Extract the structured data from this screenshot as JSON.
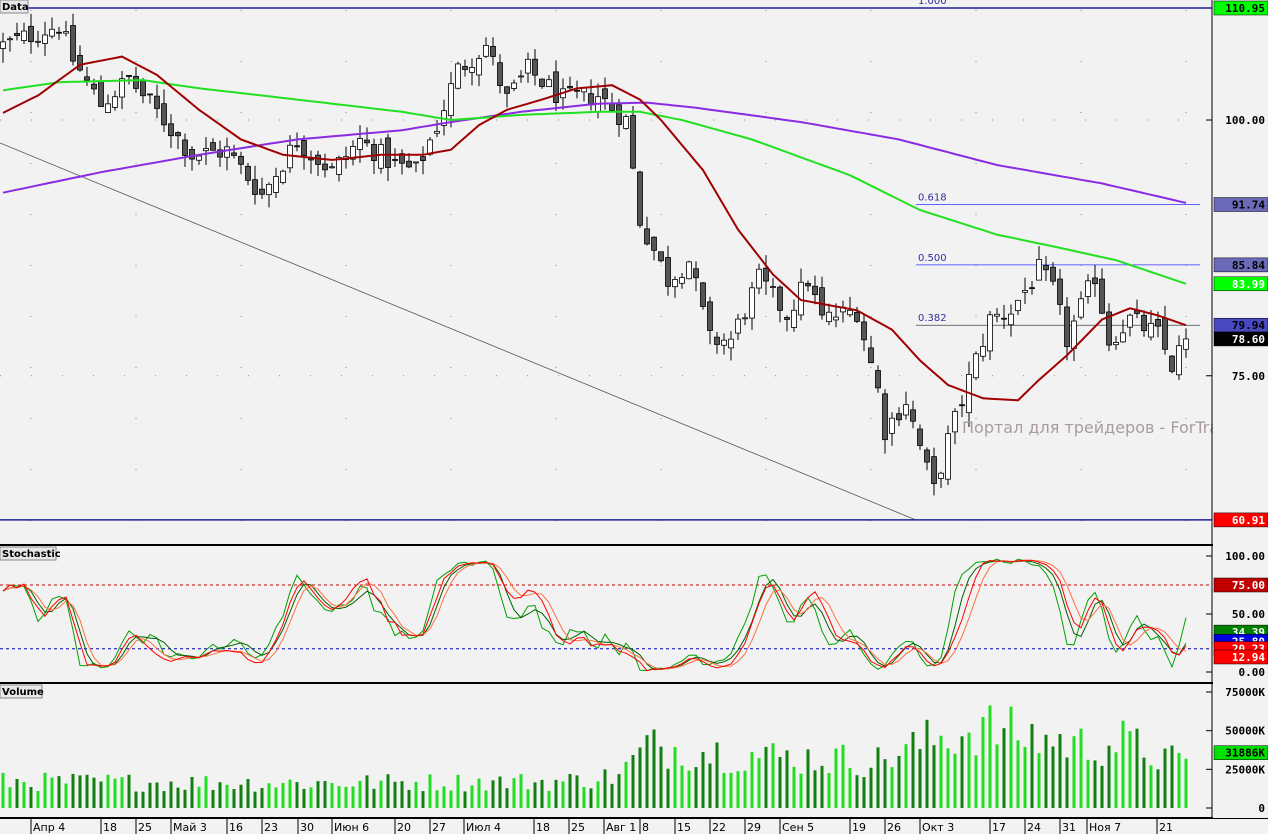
{
  "chart_data": {
    "type": "candlestick",
    "panels": {
      "price": {
        "title": "Data",
        "ylim": [
          60.91,
          110.95
        ]
      },
      "stochastic": {
        "title": "Stochastic",
        "ylim": [
          0,
          100
        ],
        "levels": [
          75,
          20
        ]
      },
      "volume": {
        "title": "Volume",
        "ylim": [
          0,
          75000
        ],
        "unit": "K"
      }
    },
    "bars": 170,
    "close_anchors": [
      [
        0,
        107.3
      ],
      [
        4,
        108.3
      ],
      [
        8,
        109.3
      ],
      [
        10,
        105.9
      ],
      [
        14,
        101.5
      ],
      [
        18,
        104
      ],
      [
        23,
        100
      ],
      [
        27,
        96.6
      ],
      [
        32,
        97
      ],
      [
        37,
        92.7
      ],
      [
        42,
        98
      ],
      [
        47,
        95
      ],
      [
        51,
        98
      ],
      [
        56,
        95.6
      ],
      [
        59,
        95
      ],
      [
        62,
        99.5
      ],
      [
        65,
        104.9
      ],
      [
        69,
        107.3
      ],
      [
        72,
        102
      ],
      [
        75,
        104.9
      ],
      [
        80,
        102
      ],
      [
        85,
        102.4
      ],
      [
        89,
        100
      ],
      [
        91,
        90.2
      ],
      [
        93,
        87.3
      ],
      [
        95,
        84.4
      ],
      [
        98,
        86.3
      ],
      [
        101,
        78.5
      ],
      [
        104,
        78.5
      ],
      [
        108,
        84.4
      ],
      [
        112,
        81
      ],
      [
        115,
        84.4
      ],
      [
        117,
        80.5
      ],
      [
        122,
        81.4
      ],
      [
        125,
        73.6
      ],
      [
        126,
        69.7
      ],
      [
        129,
        72.6
      ],
      [
        132,
        65.8
      ],
      [
        133,
        63.8
      ],
      [
        135,
        68.7
      ],
      [
        138,
        74.6
      ],
      [
        141,
        80.5
      ],
      [
        144,
        81.4
      ],
      [
        148,
        85.3
      ],
      [
        150,
        83.4
      ],
      [
        152,
        78.5
      ],
      [
        156,
        84.8
      ],
      [
        158,
        78.5
      ],
      [
        161,
        80.5
      ],
      [
        165,
        79
      ],
      [
        167,
        76
      ],
      [
        169,
        78.6
      ]
    ],
    "ma_red": [
      [
        0,
        100.7
      ],
      [
        5,
        102.4
      ],
      [
        11,
        105.4
      ],
      [
        17,
        106.2
      ],
      [
        22,
        104.4
      ],
      [
        28,
        101.0
      ],
      [
        34,
        98.1
      ],
      [
        40,
        96.6
      ],
      [
        47,
        96.1
      ],
      [
        54,
        96.6
      ],
      [
        60,
        96.6
      ],
      [
        64,
        97.1
      ],
      [
        68,
        99.5
      ],
      [
        72,
        101.0
      ],
      [
        77,
        102.0
      ],
      [
        82,
        103.1
      ],
      [
        87,
        103.4
      ],
      [
        91,
        102.0
      ],
      [
        94,
        100.0
      ],
      [
        100,
        95.1
      ],
      [
        105,
        89.3
      ],
      [
        110,
        84.9
      ],
      [
        114,
        82.4
      ],
      [
        118,
        81.9
      ],
      [
        122,
        81.4
      ],
      [
        127,
        79.5
      ],
      [
        131,
        76.5
      ],
      [
        135,
        74.1
      ],
      [
        140,
        72.8
      ],
      [
        145,
        72.6
      ],
      [
        148,
        74.6
      ],
      [
        152,
        77.0
      ],
      [
        157,
        80.5
      ],
      [
        161,
        81.6
      ],
      [
        165,
        80.9
      ],
      [
        169,
        79.94
      ]
    ],
    "ma_green": [
      [
        0,
        102.9
      ],
      [
        8,
        103.7
      ],
      [
        20,
        103.9
      ],
      [
        28,
        103.1
      ],
      [
        42,
        102.0
      ],
      [
        57,
        100.8
      ],
      [
        64,
        100.0
      ],
      [
        74,
        100.5
      ],
      [
        85,
        100.8
      ],
      [
        91,
        100.8
      ],
      [
        97,
        100.0
      ],
      [
        107,
        98.1
      ],
      [
        121,
        94.6
      ],
      [
        131,
        91.2
      ],
      [
        142,
        88.8
      ],
      [
        151,
        87.5
      ],
      [
        159,
        86.3
      ],
      [
        169,
        83.99
      ]
    ],
    "ma_purple": [
      [
        0,
        92.9
      ],
      [
        14,
        94.9
      ],
      [
        28,
        96.6
      ],
      [
        42,
        98.1
      ],
      [
        57,
        99.0
      ],
      [
        64,
        99.8
      ],
      [
        74,
        100.8
      ],
      [
        85,
        101.6
      ],
      [
        92,
        101.7
      ],
      [
        99,
        101.2
      ],
      [
        114,
        99.8
      ],
      [
        128,
        98.1
      ],
      [
        142,
        95.6
      ],
      [
        157,
        93.8
      ],
      [
        169,
        91.9
      ]
    ],
    "volume_anchors": [
      [
        0,
        18000
      ],
      [
        40,
        17000
      ],
      [
        80,
        18000
      ],
      [
        88,
        22000
      ],
      [
        92,
        42000
      ],
      [
        110,
        35000
      ],
      [
        125,
        32000
      ],
      [
        132,
        45000
      ],
      [
        140,
        55000
      ],
      [
        145,
        50000
      ],
      [
        155,
        42000
      ],
      [
        160,
        45000
      ],
      [
        169,
        28000
      ]
    ],
    "fibonacci": [
      {
        "level": "1.000",
        "price": 110.95
      },
      {
        "level": "0.618",
        "price": 91.74
      },
      {
        "level": "0.500",
        "price": 85.84
      },
      {
        "level": "0.382",
        "price": 79.94
      }
    ],
    "x_tick_labels": [
      "Апр 4",
      "18",
      "25",
      "Май 3",
      "16",
      "23",
      "30",
      "Июн 6",
      "20",
      "27",
      "Июл 4",
      "18",
      "25",
      "Авг 1",
      "8",
      "15",
      "22",
      "29",
      "Сен 5",
      "19",
      "26",
      "Окт 3",
      "17",
      "24",
      "31",
      "Ноя 7",
      "21"
    ],
    "price_axis": {
      "ticks": [
        "100.00",
        "75.00"
      ],
      "markers": [
        {
          "label": "110.95",
          "price": 110.95,
          "bg": "#00ff00",
          "fg": "#000000"
        },
        {
          "label": "91.74",
          "price": 91.74,
          "bg": "#6a6ab8",
          "fg": "#000000"
        },
        {
          "label": "85.84",
          "price": 85.84,
          "bg": "#6a6ab8",
          "fg": "#000000"
        },
        {
          "label": "83.99",
          "price": 83.99,
          "bg": "#00ff00",
          "fg": "#ffffff"
        },
        {
          "label": "79.94",
          "price": 79.94,
          "bg": "#4848c0",
          "fg": "#000000"
        },
        {
          "label": "78.60",
          "price": 78.6,
          "bg": "#000000",
          "fg": "#ffffff"
        },
        {
          "label": "60.91",
          "price": 60.91,
          "bg": "#ff0000",
          "fg": "#ffffff"
        }
      ]
    },
    "stoch_axis": {
      "ticks": [
        "100.00",
        "50.00",
        "0.00"
      ],
      "markers": [
        {
          "label": "75.00",
          "value": 75,
          "bg": "#c00000",
          "fg": "#ffffff"
        },
        {
          "label": "34.39",
          "value": 34.39,
          "bg": "#008000",
          "fg": "#ffffff"
        },
        {
          "label": "25.80",
          "value": 26.5,
          "bg": "#0000e0",
          "fg": "#ffffff"
        },
        {
          "label": "20.23",
          "value": 20.23,
          "bg": "#ff0000",
          "fg": "#ffffff"
        },
        {
          "label": "12.94",
          "value": 12.94,
          "bg": "#ff0000",
          "fg": "#ffffff"
        }
      ]
    },
    "volume_axis": {
      "ticks": [
        "75000K",
        "50000K",
        "25000K",
        "0"
      ],
      "markers": [
        {
          "label": "31886K",
          "value": 31886,
          "bg": "#00e000",
          "fg": "#000000"
        }
      ]
    },
    "colors": {
      "up": "#ffffff",
      "down": "#555555",
      "ma_red": "#a00000",
      "ma_green": "#22e022",
      "ma_purple": "#8a2be2",
      "fib": "#3030ff",
      "vol_up": "#22dd22",
      "vol_down": "#108010"
    }
  },
  "watermark": "Портал для трейдеров - ForTrader.ru"
}
